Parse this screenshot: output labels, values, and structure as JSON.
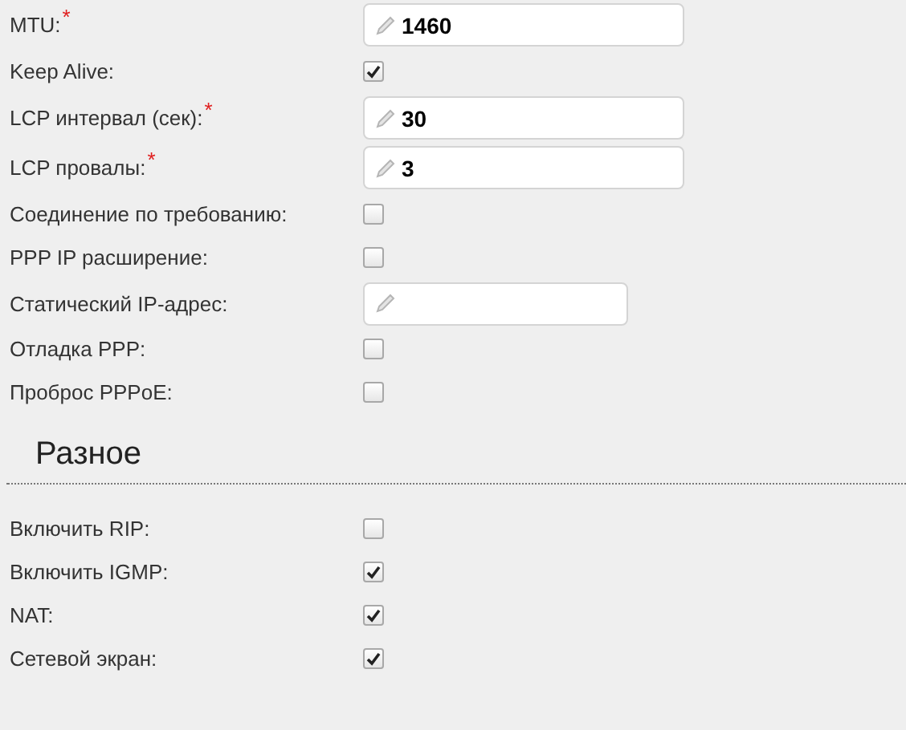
{
  "sections": [
    {
      "rows": [
        {
          "label": "MTU:",
          "required_mark": "*",
          "kind": "text",
          "value": "1460"
        },
        {
          "label": "Keep Alive:",
          "kind": "checkbox",
          "checked": true
        },
        {
          "label": "LCP интервал (сек):",
          "required_mark": "*",
          "kind": "text",
          "value": "30"
        },
        {
          "label": "LCP провалы:",
          "required_mark": "*",
          "kind": "text",
          "value": "3"
        },
        {
          "label": "Соединение по требованию:",
          "kind": "checkbox",
          "checked": false
        },
        {
          "label": "PPP IP расширение:",
          "kind": "checkbox",
          "checked": false
        },
        {
          "label": "Статический IP-адрес:",
          "kind": "ip"
        },
        {
          "label": "Отладка PPP:",
          "kind": "checkbox",
          "checked": false
        },
        {
          "label": "Проброс PPPoE:",
          "kind": "checkbox",
          "checked": false
        }
      ]
    },
    {
      "heading": "Разное",
      "rows": [
        {
          "label": "Включить RIP:",
          "kind": "checkbox",
          "checked": false
        },
        {
          "label": "Включить IGMP:",
          "kind": "checkbox",
          "checked": true
        },
        {
          "label": "NAT:",
          "kind": "checkbox",
          "checked": true
        },
        {
          "label": "Сетевой экран:",
          "kind": "checkbox",
          "checked": true
        }
      ]
    }
  ]
}
